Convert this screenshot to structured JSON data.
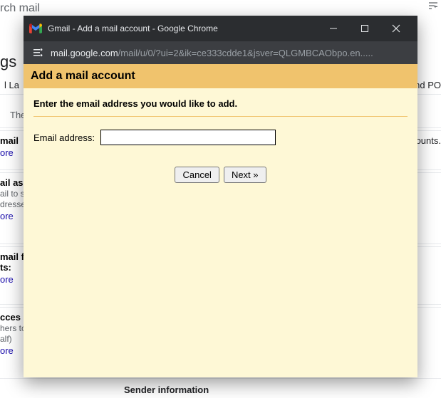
{
  "window": {
    "title": "Gmail - Add a mail account - Google Chrome",
    "url_host": "mail.google.com",
    "url_path": "/mail/u/0/?ui=2&ik=ce333cdde1&jsver=QLGMBCAObpo.en....."
  },
  "dialog": {
    "header": "Add a mail account",
    "instruction": "Enter the email address you would like to add.",
    "email_label": "Email address:",
    "email_value": "",
    "cancel_label": "Cancel",
    "next_label": "Next »"
  },
  "background": {
    "search_placeholder": "rch mail",
    "gs": "gs",
    "tab_left": "l    La",
    "tab_right": "nd PO",
    "the": "The",
    "sec1_label": "mail",
    "sec1_link": "ore",
    "accounts_note": "ounts.",
    "sec2_label": "ail as",
    "sec2_sub1": "ail to s",
    "sec2_sub2": "dresse",
    "sec2_link": "ore",
    "sec3_label": "mail f",
    "sec3_label2": "ts:",
    "sec3_link": "ore",
    "sec4_label": "cces",
    "sec4_sub1": "hers to",
    "sec4_sub2": "alf)",
    "sec4_link": "ore",
    "sender": "Sender information"
  }
}
